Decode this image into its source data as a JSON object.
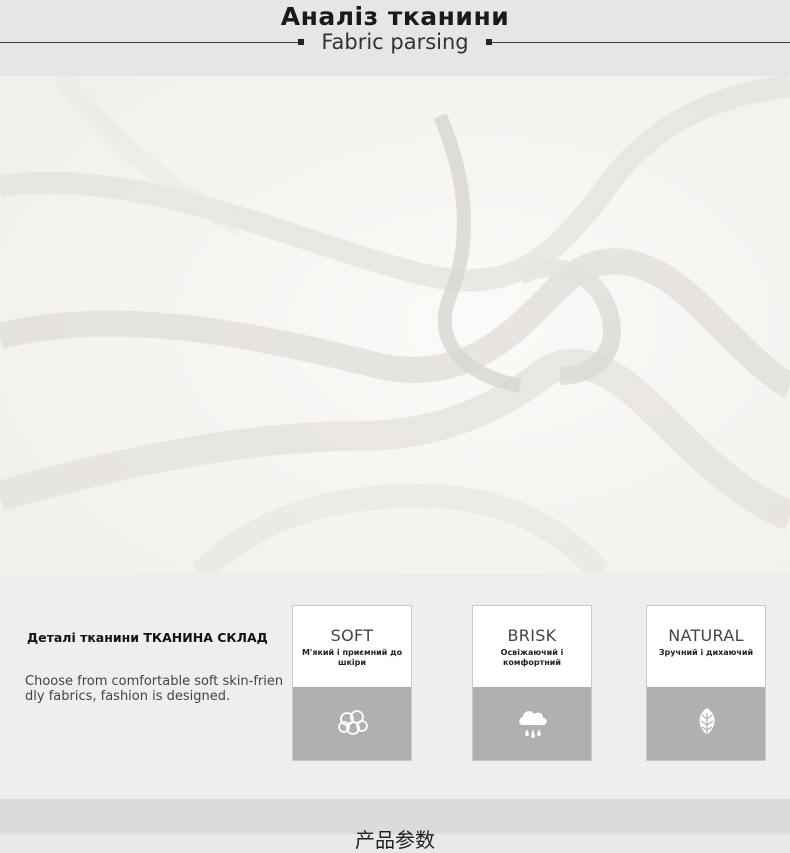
{
  "header": {
    "title": "Аналіз тканини",
    "subtitle": "Fabric parsing"
  },
  "details": {
    "title": "Деталі тканини ТКАНИНА СКЛАД",
    "description": "Choose from comfortable soft skin-friendly fabrics, fashion is designed."
  },
  "features": [
    {
      "name": "SOFT",
      "sub": "М'який і приємний до шкіри",
      "icon": "cotton-icon"
    },
    {
      "name": "BRISK",
      "sub": "Освіжаючий і комфортний",
      "icon": "cloud-rain-icon"
    },
    {
      "name": "NATURAL",
      "sub": "Зручний і дихаючий",
      "icon": "leaf-icon"
    }
  ],
  "footer": {
    "heading": "产品参数"
  },
  "colors": {
    "band": "#e4e7e6",
    "card_foot": "#b0b0b0",
    "fabric": "#f6f5f2"
  }
}
